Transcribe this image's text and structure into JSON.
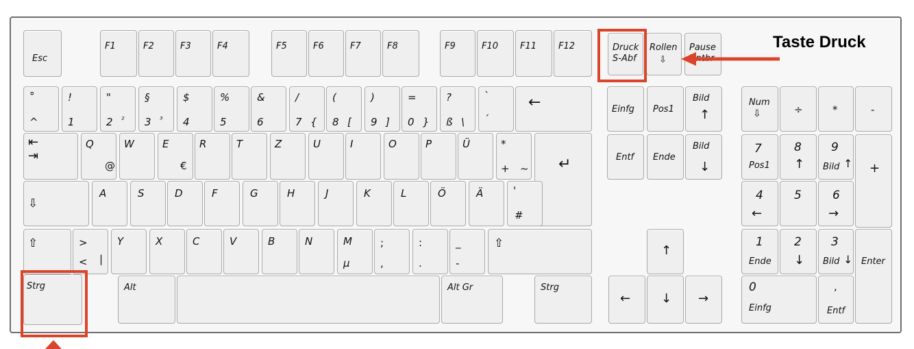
{
  "callout_title": "Taste Druck",
  "accent_color": "#d9452a",
  "keys": {
    "esc": "Esc",
    "f1": "F1",
    "f2": "F2",
    "f3": "F3",
    "f4": "F4",
    "f5": "F5",
    "f6": "F6",
    "f7": "F7",
    "f8": "F8",
    "f9": "F9",
    "f10": "F10",
    "f11": "F11",
    "f12": "F12",
    "druck_1": "Druck",
    "druck_2": "S-Abf",
    "rollen": "Rollen",
    "down_hollow": "⇩",
    "pause_1": "Pause",
    "pause_2": "Untbr",
    "caret": "^",
    "degree": "°",
    "k1": "1",
    "k1s": "!",
    "k2": "2",
    "k2s": "\"",
    "k2a": "²",
    "k3": "3",
    "k3s": "§",
    "k3a": "³",
    "k4": "4",
    "k4s": "$",
    "k5": "5",
    "k5s": "%",
    "k6": "6",
    "k6s": "&",
    "k7": "7",
    "k7s": "/",
    "k7a": "{",
    "k8": "8",
    "k8s": "(",
    "k8a": "[",
    "k9": "9",
    "k9s": ")",
    "k9a": "]",
    "k0": "0",
    "k0s": "=",
    "k0a": "}",
    "sz": "ß",
    "szs": "?",
    "sza": "\\",
    "acute_top": "`",
    "acute_bottom": "´",
    "backspace": "←",
    "tab_top": "⇤",
    "tab_bottom": "⇥",
    "q": "Q",
    "q_alt": "@",
    "w": "W",
    "e": "E",
    "e_alt": "€",
    "r": "R",
    "t": "T",
    "z": "Z",
    "u": "U",
    "i": "I",
    "o": "O",
    "p": "P",
    "ue": "Ü",
    "plus_top": "*",
    "plus": "+",
    "tilde": "~",
    "enter": "↵",
    "capslock": "⇩",
    "a": "A",
    "s": "S",
    "d": "D",
    "f": "F",
    "g": "G",
    "h": "H",
    "j": "J",
    "k": "K",
    "l": "L",
    "oe": "Ö",
    "ae": "Ä",
    "hash_top": "'",
    "hash": "#",
    "shift": "⇧",
    "lt_top": ">",
    "lt": "<",
    "pipe": "|",
    "y": "Y",
    "x": "X",
    "c": "C",
    "v": "V",
    "b": "B",
    "n": "N",
    "m": "M",
    "mu": "µ",
    "comma_top": ";",
    "comma": ",",
    "period_top": ":",
    "period": ".",
    "minus_top": "_",
    "minus": "-",
    "strg": "Strg",
    "alt": "Alt",
    "altgr": "Alt Gr",
    "einfg": "Einfg",
    "pos1": "Pos1",
    "bild": "Bild",
    "entf": "Entf",
    "ende": "Ende",
    "up": "↑",
    "down": "↓",
    "left": "←",
    "right": "→",
    "num": "Num",
    "div": "÷",
    "mul": "*",
    "sub": "-",
    "add": "+",
    "enter_label": "Enter",
    "n7": "7",
    "n8": "8",
    "n9": "9",
    "n4": "4",
    "n5": "5",
    "n6": "6",
    "n1": "1",
    "n2": "2",
    "n3": "3",
    "n0": "0",
    "ndot": ","
  }
}
